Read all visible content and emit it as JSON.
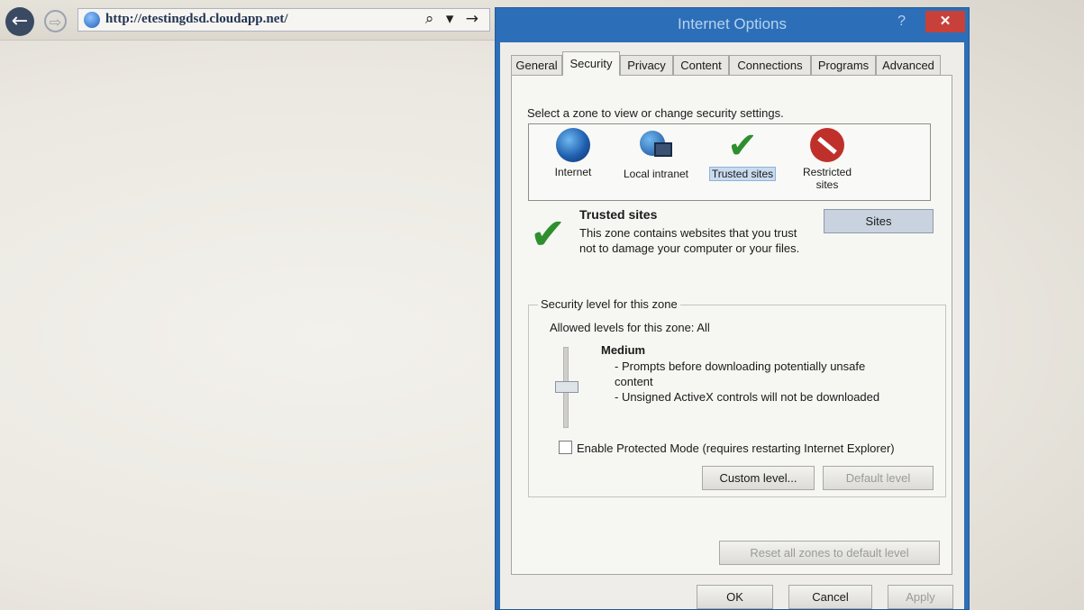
{
  "browser": {
    "url": "http://etestingdsd.cloudapp.net/",
    "back_glyph": "←",
    "forward_glyph": "⇨",
    "address_tools": "⌕ ▾ →"
  },
  "dialog": {
    "title": "Internet Options",
    "help_glyph": "?",
    "close_glyph": "✕",
    "tabs": [
      "General",
      "Security",
      "Privacy",
      "Content",
      "Connections",
      "Programs",
      "Advanced"
    ],
    "active_tab": "Security",
    "zone_prompt": "Select a zone to view or change security settings.",
    "zones": [
      {
        "label": "Internet",
        "icon": "globe-icon"
      },
      {
        "label": "Local intranet",
        "icon": "network-icon"
      },
      {
        "label": "Trusted sites",
        "icon": "check-icon"
      },
      {
        "label": "Restricted sites",
        "icon": "no-entry-icon"
      }
    ],
    "selected_zone": "Trusted sites",
    "zone_info": {
      "title": "Trusted sites",
      "description": "This zone contains websites that you trust not to damage your computer or your files."
    },
    "sites_button": "Sites",
    "security_group": {
      "title": "Security level for this zone",
      "allowed": "Allowed levels for this zone: All",
      "level_name": "Medium",
      "level_line_1": "- Prompts before downloading potentially unsafe content",
      "level_line_2": "- Unsigned ActiveX controls will not be downloaded",
      "protected_mode": "Enable Protected Mode (requires restarting Internet Explorer)",
      "protected_checked": false,
      "custom_level": "Custom level...",
      "default_level": "Default level"
    },
    "reset_all": "Reset all zones to default level",
    "ok": "OK",
    "cancel": "Cancel",
    "apply": "Apply"
  },
  "colors": {
    "dialog_frame": "#2c6fb8",
    "close_button": "#c7413a",
    "check_green": "#2f8f2f"
  }
}
